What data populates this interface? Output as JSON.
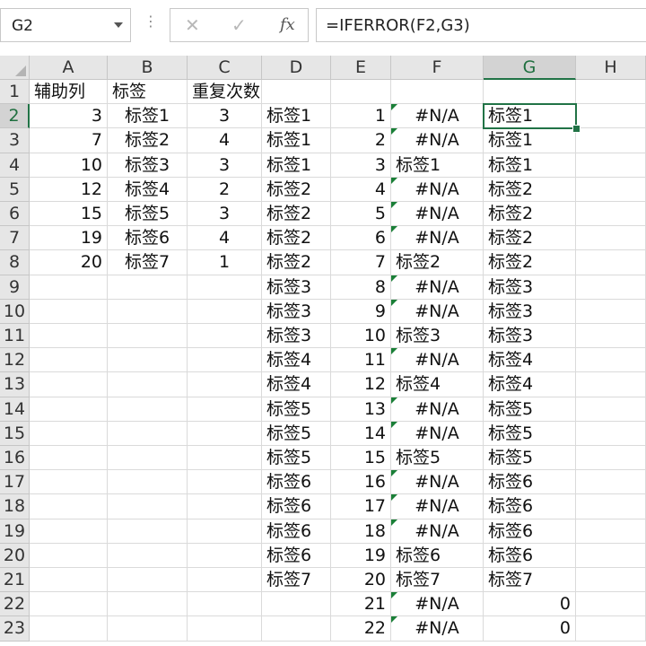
{
  "name_box": "G2",
  "formula": "=IFERROR(F2,G3)",
  "formula_buttons": {
    "cancel": "✕",
    "enter": "✓",
    "fx": "fx"
  },
  "columns": [
    "A",
    "B",
    "C",
    "D",
    "E",
    "F",
    "G",
    "H"
  ],
  "active_cell": {
    "col": "G",
    "row": 2
  },
  "rows": [
    {
      "n": "1",
      "A": "辅助列",
      "B": "标签",
      "C": "重复次数",
      "D": "",
      "E": "",
      "F": "",
      "G": ""
    },
    {
      "n": "2",
      "A": "3",
      "B": "标签1",
      "C": "3",
      "D": "标签1",
      "E": "1",
      "F": "#N/A",
      "G": "标签1"
    },
    {
      "n": "3",
      "A": "7",
      "B": "标签2",
      "C": "4",
      "D": "标签1",
      "E": "2",
      "F": "#N/A",
      "G": "标签1"
    },
    {
      "n": "4",
      "A": "10",
      "B": "标签3",
      "C": "3",
      "D": "标签1",
      "E": "3",
      "F": "标签1",
      "G": "标签1"
    },
    {
      "n": "5",
      "A": "12",
      "B": "标签4",
      "C": "2",
      "D": "标签2",
      "E": "4",
      "F": "#N/A",
      "G": "标签2"
    },
    {
      "n": "6",
      "A": "15",
      "B": "标签5",
      "C": "3",
      "D": "标签2",
      "E": "5",
      "F": "#N/A",
      "G": "标签2"
    },
    {
      "n": "7",
      "A": "19",
      "B": "标签6",
      "C": "4",
      "D": "标签2",
      "E": "6",
      "F": "#N/A",
      "G": "标签2"
    },
    {
      "n": "8",
      "A": "20",
      "B": "标签7",
      "C": "1",
      "D": "标签2",
      "E": "7",
      "F": "标签2",
      "G": "标签2"
    },
    {
      "n": "9",
      "A": "",
      "B": "",
      "C": "",
      "D": "标签3",
      "E": "8",
      "F": "#N/A",
      "G": "标签3"
    },
    {
      "n": "10",
      "A": "",
      "B": "",
      "C": "",
      "D": "标签3",
      "E": "9",
      "F": "#N/A",
      "G": "标签3"
    },
    {
      "n": "11",
      "A": "",
      "B": "",
      "C": "",
      "D": "标签3",
      "E": "10",
      "F": "标签3",
      "G": "标签3"
    },
    {
      "n": "12",
      "A": "",
      "B": "",
      "C": "",
      "D": "标签4",
      "E": "11",
      "F": "#N/A",
      "G": "标签4"
    },
    {
      "n": "13",
      "A": "",
      "B": "",
      "C": "",
      "D": "标签4",
      "E": "12",
      "F": "标签4",
      "G": "标签4"
    },
    {
      "n": "14",
      "A": "",
      "B": "",
      "C": "",
      "D": "标签5",
      "E": "13",
      "F": "#N/A",
      "G": "标签5"
    },
    {
      "n": "15",
      "A": "",
      "B": "",
      "C": "",
      "D": "标签5",
      "E": "14",
      "F": "#N/A",
      "G": "标签5"
    },
    {
      "n": "16",
      "A": "",
      "B": "",
      "C": "",
      "D": "标签5",
      "E": "15",
      "F": "标签5",
      "G": "标签5"
    },
    {
      "n": "17",
      "A": "",
      "B": "",
      "C": "",
      "D": "标签6",
      "E": "16",
      "F": "#N/A",
      "G": "标签6"
    },
    {
      "n": "18",
      "A": "",
      "B": "",
      "C": "",
      "D": "标签6",
      "E": "17",
      "F": "#N/A",
      "G": "标签6"
    },
    {
      "n": "19",
      "A": "",
      "B": "",
      "C": "",
      "D": "标签6",
      "E": "18",
      "F": "#N/A",
      "G": "标签6"
    },
    {
      "n": "20",
      "A": "",
      "B": "",
      "C": "",
      "D": "标签6",
      "E": "19",
      "F": "标签6",
      "G": "标签6"
    },
    {
      "n": "21",
      "A": "",
      "B": "",
      "C": "",
      "D": "标签7",
      "E": "20",
      "F": "标签7",
      "G": "标签7"
    },
    {
      "n": "22",
      "A": "",
      "B": "",
      "C": "",
      "D": "",
      "E": "21",
      "F": "#N/A",
      "G": "0"
    },
    {
      "n": "23",
      "A": "",
      "B": "",
      "C": "",
      "D": "",
      "E": "22",
      "F": "#N/A",
      "G": "0"
    }
  ]
}
